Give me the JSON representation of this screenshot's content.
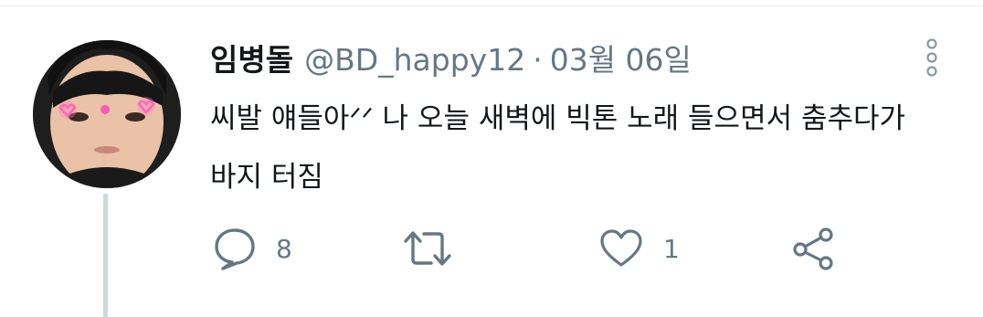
{
  "tweet": {
    "display_name": "임병돌",
    "handle": "@BD_happy12",
    "separator": "·",
    "date": "03월 06일",
    "text": "씨발 얘들아ᐟᐟ 나 오늘 새벽에 빅톤 노래 들으면서 춤추다가 바지 터짐"
  },
  "actions": {
    "reply_count": "8",
    "retweet_count": "",
    "like_count": "1"
  },
  "icons": {
    "reply": "reply-bubble-icon",
    "retweet": "retweet-icon",
    "like": "heart-icon",
    "share": "share-icon",
    "more": "more-vertical-icon"
  },
  "colors": {
    "text": "#14171a",
    "secondary": "#657786",
    "icon": "#657786",
    "thread_line": "#ccd6dd"
  }
}
